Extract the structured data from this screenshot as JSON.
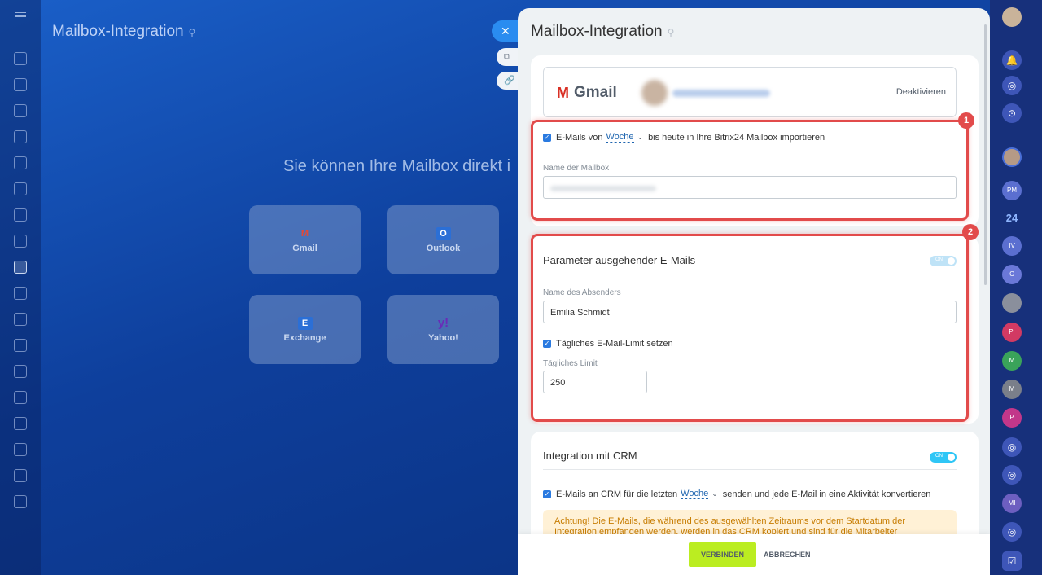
{
  "background": {
    "title": "Mailbox-Integration",
    "center_text": "Sie können Ihre Mailbox direkt i",
    "services": [
      {
        "label": "Gmail",
        "icon": "gmail-icon",
        "glyph": "M"
      },
      {
        "label": "Outlook",
        "icon": "outlook-icon",
        "glyph": "O"
      },
      {
        "label": "Exchange",
        "icon": "exchange-icon",
        "glyph": "E"
      },
      {
        "label": "Yahoo!",
        "icon": "yahoo-icon",
        "glyph": "y!"
      }
    ]
  },
  "slider": {
    "title": "Mailbox-Integration",
    "close_glyph": "✕",
    "provider": {
      "name": "Gmail",
      "glyph": "M",
      "deactivate_label": "Deaktivieren"
    },
    "import": {
      "prefix": "E-Mails von",
      "period": "Woche",
      "suffix": "bis heute in Ihre Bitrix24 Mailbox importieren"
    },
    "mailbox_name_label": "Name der Mailbox",
    "outgoing": {
      "title": "Parameter ausgehender E-Mails",
      "toggle_label": "ON",
      "sender_label": "Name des Absenders",
      "sender_value": "Emilia Schmidt",
      "limit_checkbox": "Tägliches E-Mail-Limit setzen",
      "limit_label": "Tägliches Limit",
      "limit_value": "250"
    },
    "crm": {
      "title": "Integration mit CRM",
      "toggle_label": "ON",
      "prefix": "E-Mails an CRM für die letzten",
      "period": "Woche",
      "suffix": "senden und jede E-Mail in eine Aktivität konvertieren",
      "warning": "Achtung! Die E-Mails, die während des ausgewählten Zeitraums vor dem Startdatum der Integration empfangen werden, werden in das CRM kopiert und sind für die Mitarbeiter"
    },
    "footer": {
      "connect": "VERBINDEN",
      "cancel": "ABBRECHEN"
    }
  },
  "annotations": {
    "badge1": "1",
    "badge2": "2",
    "color": "#e24b4b"
  },
  "right_rail": {
    "avatars": [
      {
        "initials": "PM",
        "color": "#5b6fd0"
      },
      {
        "initials": "24",
        "color": "#17307b"
      },
      {
        "initials": "IV",
        "color": "#5b6fd0"
      },
      {
        "initials": "C",
        "color": "#6a78d8"
      },
      {
        "initials": "PI",
        "color": "#d23a63"
      },
      {
        "initials": "M",
        "color": "#3aa35a"
      },
      {
        "initials": "M",
        "color": "#7a7f8a"
      },
      {
        "initials": "P",
        "color": "#c2378a"
      },
      {
        "initials": "MI",
        "color": "#6d5fc0"
      }
    ]
  }
}
